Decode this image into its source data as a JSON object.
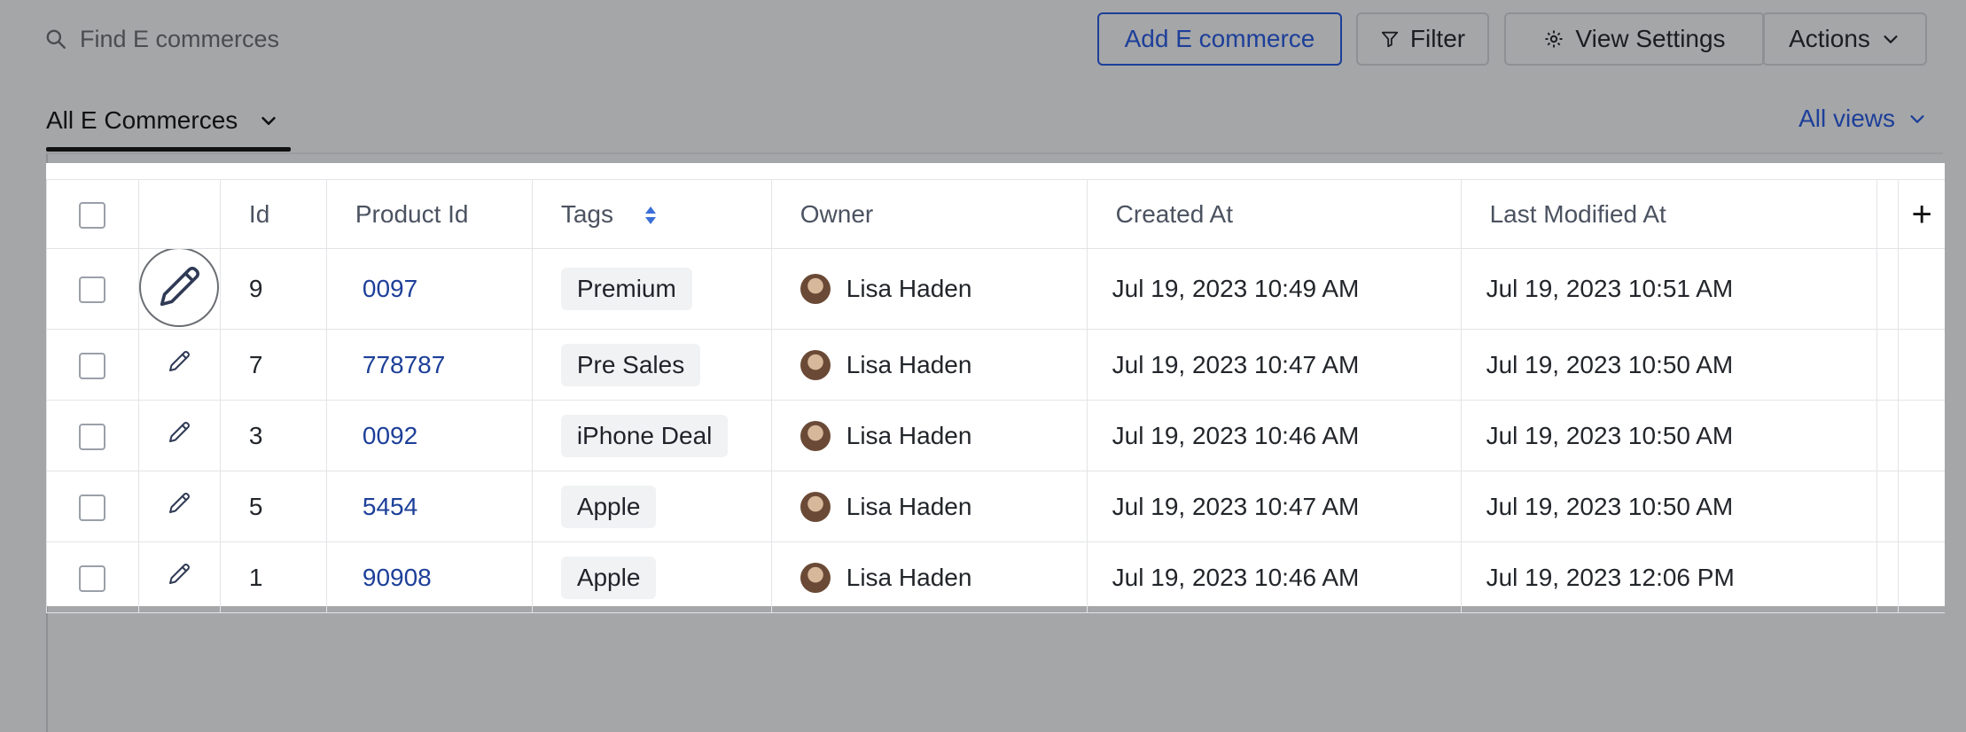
{
  "toolbar": {
    "search_placeholder": "Find E commerces",
    "add_label": "Add E commerce",
    "filter_label": "Filter",
    "view_settings_label": "View Settings",
    "actions_label": "Actions"
  },
  "tabs": {
    "active_label": "All E Commerces",
    "all_views_label": "All views"
  },
  "table": {
    "headers": {
      "id": "Id",
      "product_id": "Product Id",
      "tags": "Tags",
      "owner": "Owner",
      "created_at": "Created At",
      "last_modified_at": "Last Modified At",
      "add_column": "+"
    },
    "rows": [
      {
        "id": "9",
        "product_id": "0097",
        "tag": "Premium",
        "owner": "Lisa Haden",
        "created_at": "Jul 19, 2023 10:49 AM",
        "last_modified_at": "Jul 19, 2023 10:51 AM"
      },
      {
        "id": "7",
        "product_id": "778787",
        "tag": "Pre Sales",
        "owner": "Lisa Haden",
        "created_at": "Jul 19, 2023 10:47 AM",
        "last_modified_at": "Jul 19, 2023 10:50 AM"
      },
      {
        "id": "3",
        "product_id": "0092",
        "tag": "iPhone Deal",
        "owner": "Lisa Haden",
        "created_at": "Jul 19, 2023 10:46 AM",
        "last_modified_at": "Jul 19, 2023 10:50 AM"
      },
      {
        "id": "5",
        "product_id": "5454",
        "tag": "Apple",
        "owner": "Lisa Haden",
        "created_at": "Jul 19, 2023 10:47 AM",
        "last_modified_at": "Jul 19, 2023 10:50 AM"
      },
      {
        "id": "1",
        "product_id": "90908",
        "tag": "Apple",
        "owner": "Lisa Haden",
        "created_at": "Jul 19, 2023 10:46 AM",
        "last_modified_at": "Jul 19, 2023 12:06 PM"
      }
    ]
  },
  "icons": {
    "search": "search-icon",
    "filter": "filter-icon",
    "gear": "gear-icon",
    "chevron": "chevron-down-icon",
    "sort": "sort-icon",
    "edit": "pencil-icon",
    "avatar": "avatar"
  },
  "colors": {
    "accent": "#1d3f99",
    "overlay": "#a5a6a8"
  }
}
